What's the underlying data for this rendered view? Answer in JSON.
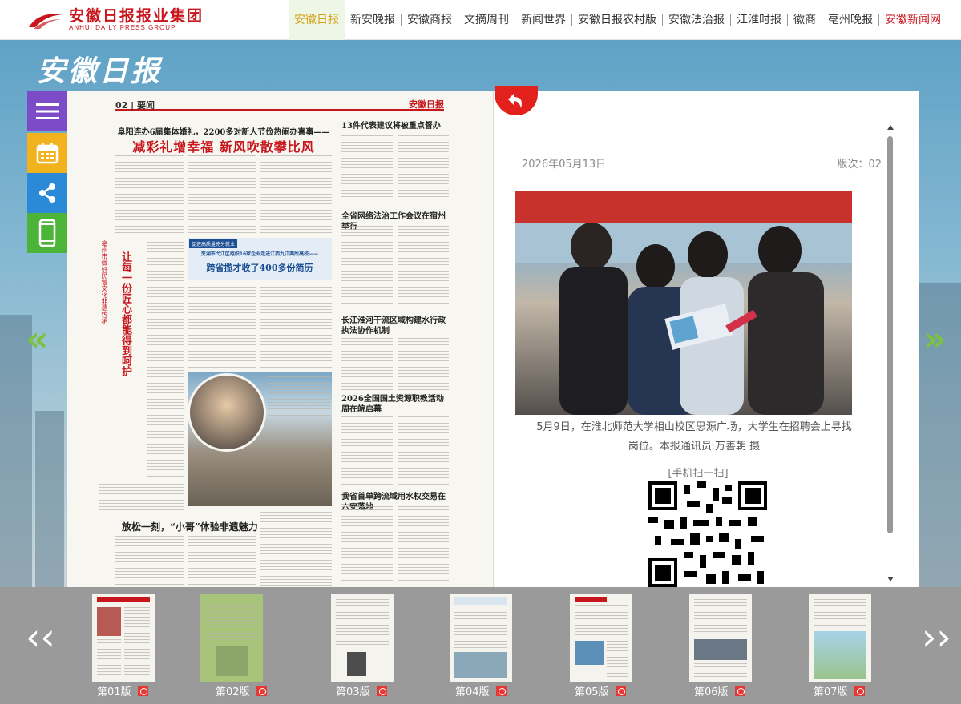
{
  "header": {
    "logo_name": "安徽日报报业集团",
    "logo_en": "ANHUI DAILY PRESS GROUP",
    "nav": [
      {
        "label": "安徽日报",
        "state": "active"
      },
      {
        "label": "新安晚报"
      },
      {
        "label": "安徽商报"
      },
      {
        "label": "文摘周刊"
      },
      {
        "label": "新闻世界"
      },
      {
        "label": "安徽日报农村版"
      },
      {
        "label": "安徽法治报"
      },
      {
        "label": "江淮时报"
      },
      {
        "label": "徽商"
      },
      {
        "label": "亳州晚报"
      },
      {
        "label": "安徽新闻网",
        "state": "highlight"
      }
    ]
  },
  "masthead": "安徽日报",
  "sidebar": {
    "icons": [
      "menu-icon",
      "calendar-icon",
      "share-icon",
      "phone-icon"
    ]
  },
  "newspaper_page": {
    "page_label": "02 | 要闻",
    "brand": "安徽日报",
    "headlines": {
      "top_kicker": "阜阳连办6届集体婚礼，2200多对新人节俭热闹办喜事——",
      "top_main": "减彩礼增幸福 新风吹散攀比风",
      "vertical_title": "让每一份匠心都能得到呵护",
      "vertical_sub": "亳州市做好民营文化非遗传承",
      "blue_box_tag": "促进高质量充分就业",
      "blue_box_kicker": "芜湖市弋江区组织16家企业走进江西九江两所高校——",
      "blue_box_main": "跨省揽才收了400多份简历",
      "right_1": "13件代表建议将被重点督办",
      "right_2": "全省网络法治工作会议在宿州举行",
      "right_3": "长江淮河干流区域构建水行政执法协作机制",
      "right_4": "2026全国国土资源职教活动周在皖启幕",
      "right_5": "我省首单跨流域用水权交易在六安落地",
      "bottom": "放松一刻，“小哥”体验非遗魅力"
    }
  },
  "reader": {
    "date": "2026年05月13日",
    "version": "版次：02",
    "caption": "5月9日，在淮北师范大学相山校区思源广场，大学生在招聘会上寻找岗位。本报通讯员 万善朝 摄",
    "scan_label": "[手机扫一扫]"
  },
  "thumbnails": [
    {
      "label": "第01版"
    },
    {
      "label": "第02版",
      "state": "active"
    },
    {
      "label": "第03版"
    },
    {
      "label": "第04版"
    },
    {
      "label": "第05版"
    },
    {
      "label": "第06版"
    },
    {
      "label": "第07版"
    }
  ],
  "colors": {
    "brand_red": "#c8161d",
    "active_nav": "#d4a017",
    "arrow_green": "#7cc142"
  }
}
